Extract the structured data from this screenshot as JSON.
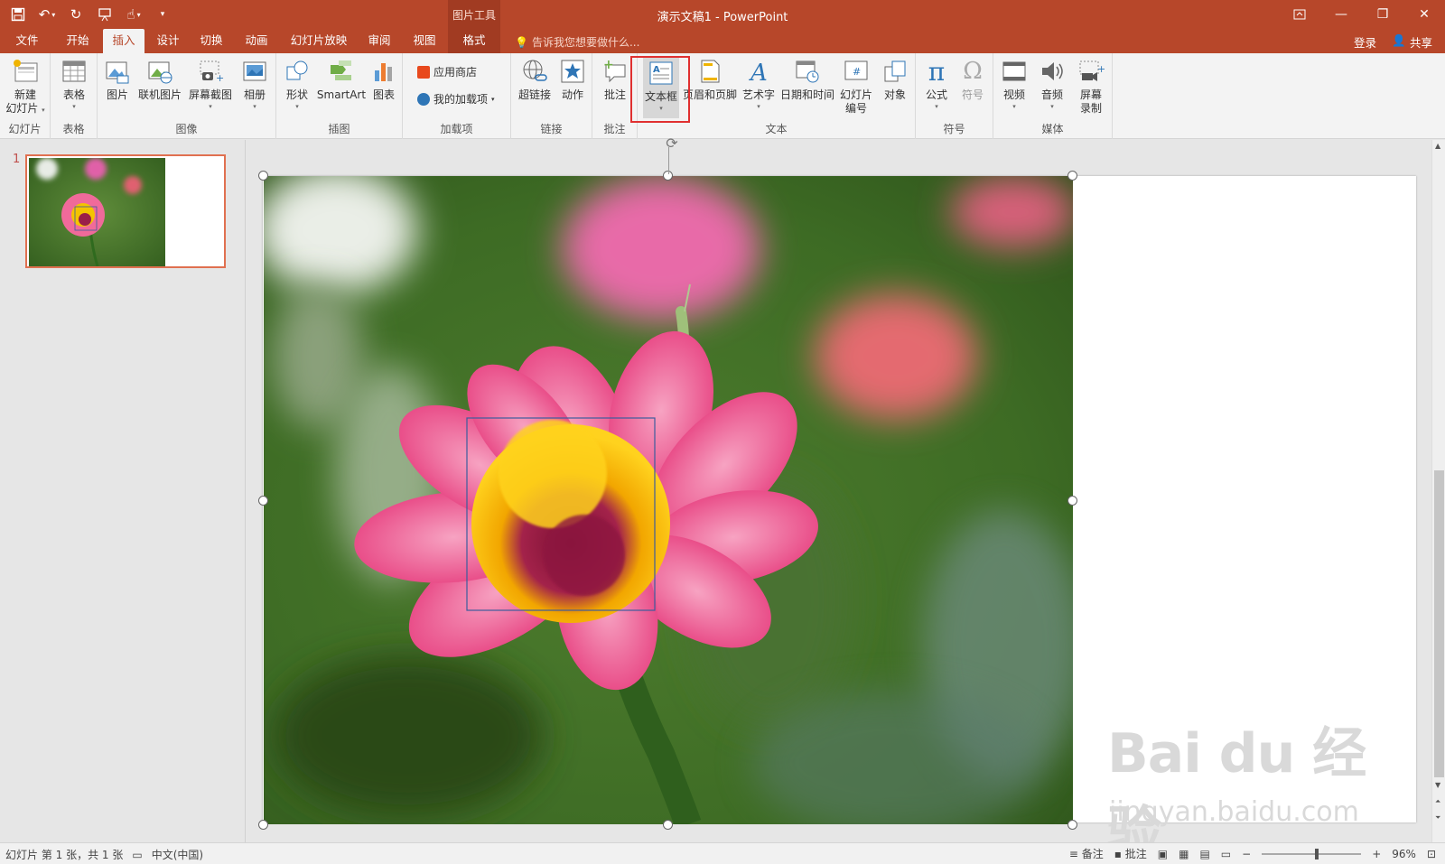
{
  "app": {
    "window_title": "演示文稿1 - PowerPoint",
    "context_group": "图片工具"
  },
  "qat": {
    "save_icon": "save-icon",
    "undo_icon": "undo-icon",
    "redo_icon": "redo-icon",
    "start_icon": "present-icon",
    "touch_icon": "touch-mode-icon"
  },
  "tabs": [
    {
      "label": "文件"
    },
    {
      "label": "开始"
    },
    {
      "label": "插入"
    },
    {
      "label": "设计"
    },
    {
      "label": "切换"
    },
    {
      "label": "动画"
    },
    {
      "label": "幻灯片放映"
    },
    {
      "label": "审阅"
    },
    {
      "label": "视图"
    },
    {
      "label": "格式"
    }
  ],
  "tell_me": "告诉我您想要做什么...",
  "signin": "登录",
  "share": "共享",
  "ribbon": {
    "groups": {
      "slides": "幻灯片",
      "tables": "表格",
      "images": "图像",
      "illustrations": "插图",
      "addins": "加载项",
      "links": "链接",
      "comments": "批注",
      "text": "文本",
      "symbols": "符号",
      "media": "媒体"
    },
    "buttons": {
      "new_slide_1": "新建",
      "new_slide_2": "幻灯片",
      "table": "表格",
      "picture": "图片",
      "online_picture": "联机图片",
      "screenshot": "屏幕截图",
      "album": "相册",
      "shapes": "形状",
      "smartart": "SmartArt",
      "chart": "图表",
      "store": "应用商店",
      "my_addins": "我的加载项",
      "hyperlink": "超链接",
      "action": "动作",
      "comment": "批注",
      "textbox": "文本框",
      "header_footer": "页眉和页脚",
      "wordart": "艺术字",
      "datetime": "日期和时间",
      "slide_number_1": "幻灯片",
      "slide_number_2": "编号",
      "object": "对象",
      "equation": "公式",
      "symbol": "符号",
      "video": "视频",
      "audio": "音频",
      "screen_record_1": "屏幕",
      "screen_record_2": "录制"
    }
  },
  "thumbnail": {
    "number": "1"
  },
  "watermark": {
    "logo": "Bai du 经验",
    "url": "jingyan.baidu.com"
  },
  "status": {
    "slide_info": "幻灯片 第 1 张，共 1 张",
    "language": "中文(中国)",
    "notes": "备注",
    "comments": "批注",
    "zoom": "96%",
    "zoom_level": 0.55
  },
  "colors": {
    "accent": "#b7472a",
    "highlight_box": "#e03030"
  }
}
